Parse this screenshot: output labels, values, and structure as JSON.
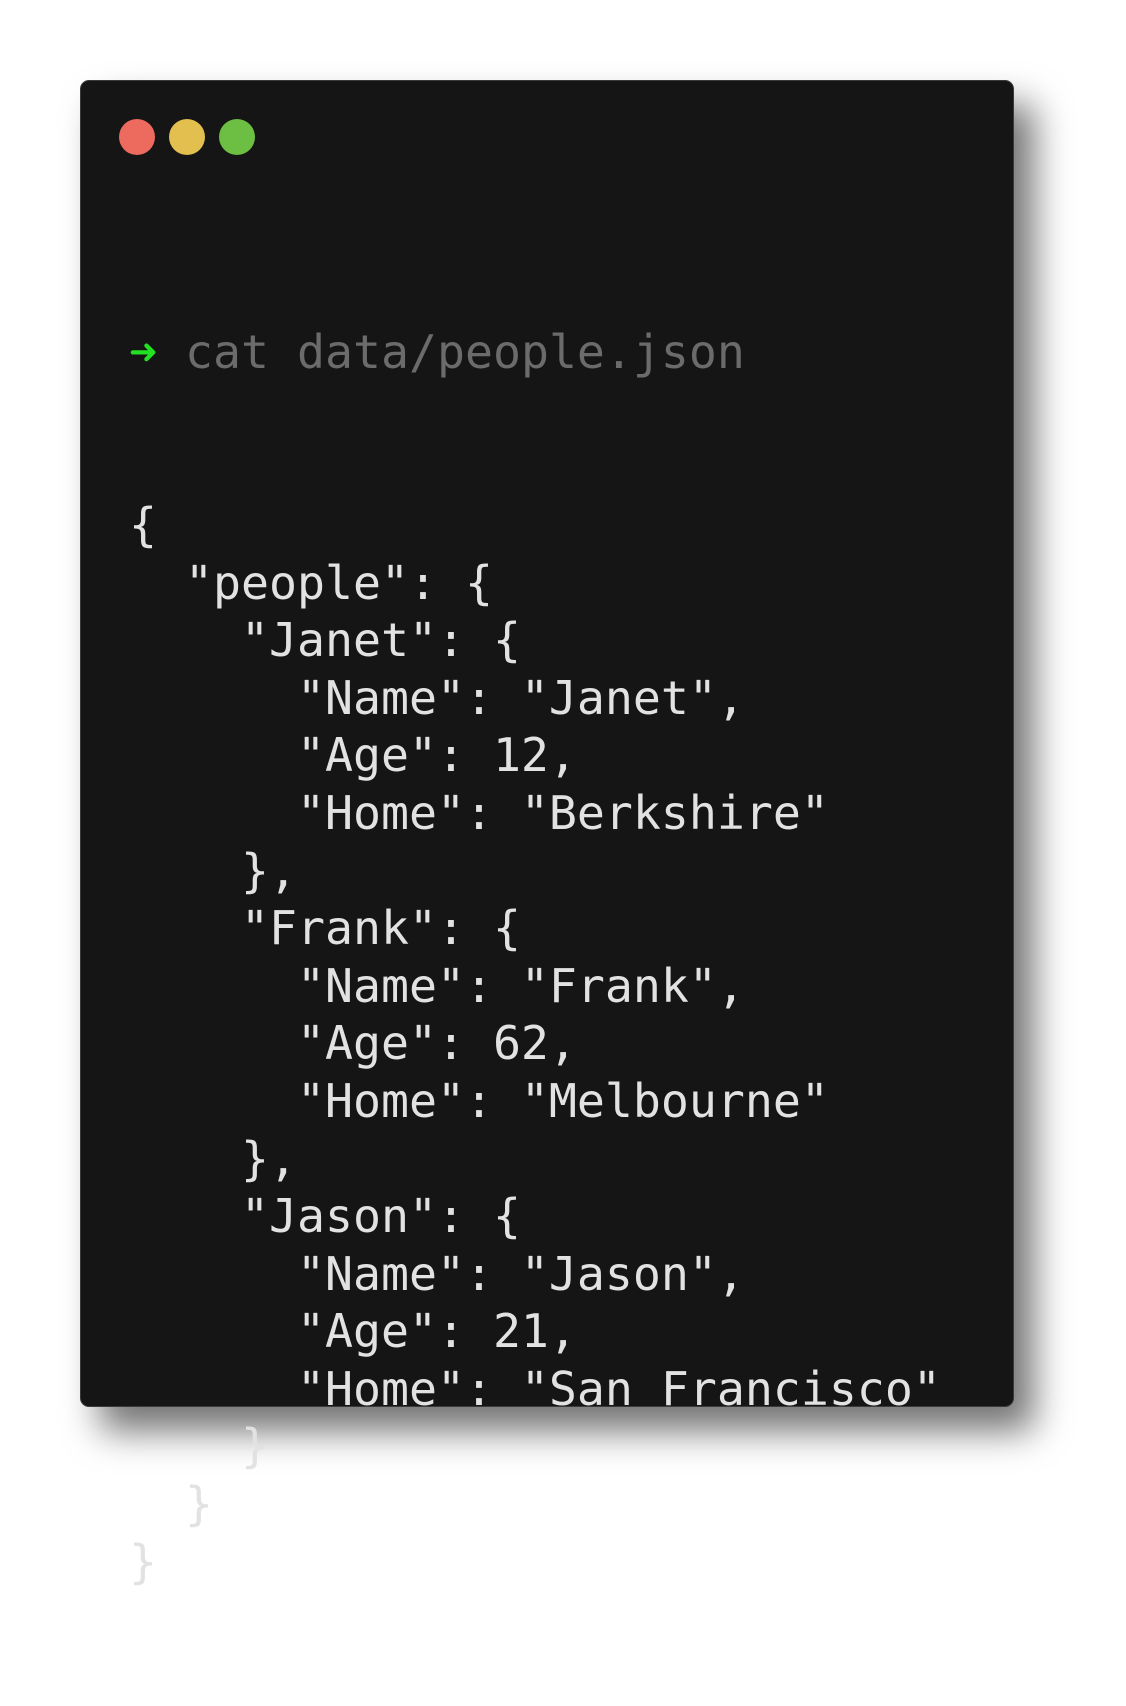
{
  "window": {
    "controls": [
      {
        "name": "close",
        "color": "#ed6a5e"
      },
      {
        "name": "minimize",
        "color": "#e3bf4f"
      },
      {
        "name": "maximize",
        "color": "#6cbf43"
      }
    ]
  },
  "colors": {
    "background": "#151515",
    "text": "#e2e2e2",
    "command": "#6b6b6b",
    "prompt": "#22e022"
  },
  "terminal": {
    "prompt_symbol": "➜",
    "command": "cat data/people.json",
    "output": [
      "{",
      "  \"people\": {",
      "    \"Janet\": {",
      "      \"Name\": \"Janet\",",
      "      \"Age\": 12,",
      "      \"Home\": \"Berkshire\"",
      "    },",
      "    \"Frank\": {",
      "      \"Name\": \"Frank\",",
      "      \"Age\": 62,",
      "      \"Home\": \"Melbourne\"",
      "    },",
      "    \"Jason\": {",
      "      \"Name\": \"Jason\",",
      "      \"Age\": 21,",
      "      \"Home\": \"San Francisco\"",
      "    }",
      "  }",
      "}"
    ]
  }
}
